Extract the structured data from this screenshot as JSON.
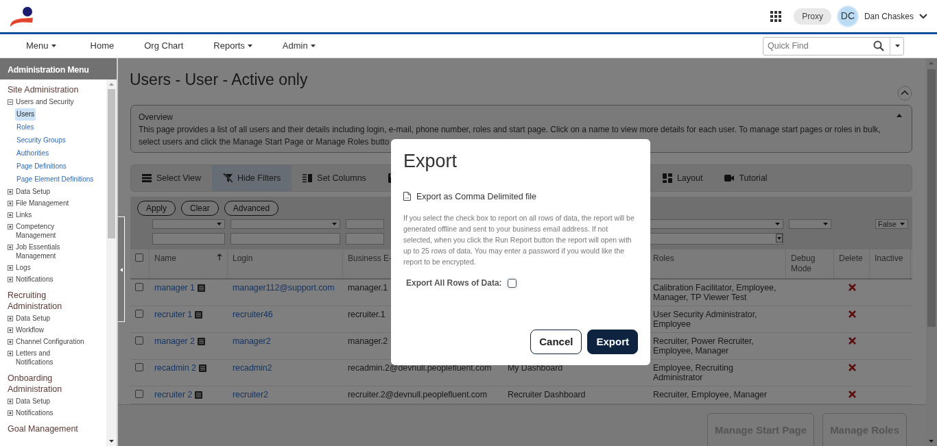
{
  "header": {
    "proxy": "Proxy",
    "avatar": "DC",
    "user": "Dan Chaskes"
  },
  "nav": [
    {
      "label": "Menu",
      "dropdown": true
    },
    {
      "label": "Home",
      "dropdown": false
    },
    {
      "label": "Org Chart",
      "dropdown": false
    },
    {
      "label": "Reports",
      "dropdown": true
    },
    {
      "label": "Admin",
      "dropdown": true
    }
  ],
  "quick_find": {
    "placeholder": "Quick Find"
  },
  "sidebar": {
    "title": "Administration Menu",
    "sections": [
      {
        "title": "Site Administration",
        "items": [
          {
            "label": "Users and Security",
            "expanded": true,
            "children": [
              {
                "label": "Users",
                "selected": true
              },
              {
                "label": "Roles",
                "selected": false
              },
              {
                "label": "Security Groups",
                "selected": false
              },
              {
                "label": "Authorities",
                "selected": false
              },
              {
                "label": "Page Definitions",
                "selected": false
              },
              {
                "label": "Page Element Definitions",
                "selected": false
              }
            ]
          },
          {
            "label": "Data Setup",
            "expanded": false
          },
          {
            "label": "File Management",
            "expanded": false
          },
          {
            "label": "Links",
            "expanded": false
          },
          {
            "label": "Competency Management",
            "expanded": false
          },
          {
            "label": "Job Essentials Management",
            "expanded": false
          },
          {
            "label": "Logs",
            "expanded": false
          },
          {
            "label": "Notifications",
            "expanded": false
          }
        ]
      },
      {
        "title": "Recruiting Administration",
        "items": [
          {
            "label": "Data Setup",
            "expanded": false
          },
          {
            "label": "Workflow",
            "expanded": false
          },
          {
            "label": "Channel Configuration",
            "expanded": false
          },
          {
            "label": "Letters and Notifications",
            "expanded": false
          }
        ]
      },
      {
        "title": "Onboarding Administration",
        "items": [
          {
            "label": "Data Setup",
            "expanded": false
          },
          {
            "label": "Notifications",
            "expanded": false
          }
        ]
      },
      {
        "title": "Goal Management"
      }
    ]
  },
  "page": {
    "title": "Users - User - Active only"
  },
  "overview": {
    "title": "Overview",
    "lines": [
      "This page provides a list of all users and their details including login, e-mail, phone number, roles and start page. Click on a name to view more details for each user. To manage start pages or roles in bulk,",
      "select users and click the Manage Start Page or Manage Roles butto"
    ]
  },
  "toolbar": [
    {
      "kind": "list",
      "label": "Select View",
      "selected": false
    },
    {
      "kind": "filter",
      "label": "Hide Filters",
      "selected": true
    },
    {
      "kind": "columns",
      "label": "Set Columns",
      "selected": false
    },
    {
      "kind": "save",
      "selected": false
    },
    {
      "kind": "layout",
      "label": "Layout",
      "selected": false
    },
    {
      "kind": "video",
      "label": "Tutorial",
      "selected": false
    }
  ],
  "filter_buttons": [
    "Apply",
    "Clear",
    "Advanced"
  ],
  "columns": [
    {
      "kind": "check",
      "checked": false
    },
    {
      "label": "Name",
      "sorted": true,
      "filters": [
        {
          "kind": "select"
        },
        {
          "kind": "text"
        }
      ]
    },
    {
      "label": "Login",
      "filters": [
        {
          "kind": "select"
        },
        {
          "kind": "text"
        }
      ]
    },
    {
      "label": "Business E-",
      "filters": [
        {
          "kind": "select"
        },
        {
          "kind": "text"
        }
      ]
    },
    {
      "kind": "hidden"
    },
    {
      "label": "Roles",
      "filters": [
        {
          "kind": "select"
        },
        {
          "kind": "dropdown"
        }
      ]
    },
    {
      "label": "Debug Mode",
      "filters": [
        {
          "kind": "select"
        }
      ]
    },
    {
      "label": "Delete"
    },
    {
      "label": "Inactive",
      "filters": [
        {
          "kind": "select",
          "value": "False"
        }
      ]
    }
  ],
  "rows": [
    {
      "checked": false,
      "name": "manager 1",
      "login": "manager112@support.com",
      "email": "manager.1",
      "roles": "Calibration Facilitator, Employee, Manager, TP Viewer Test",
      "delete": true
    },
    {
      "checked": false,
      "name": "recruiter 1",
      "login": "recruiter46",
      "email": "recruiter.1",
      "roles": "User Security Administrator, Employee",
      "delete": true
    },
    {
      "checked": false,
      "name": "manager 2",
      "login": "manager2",
      "email": "manager.2",
      "roles": "Recruiter, Power Recruiter, Employee, Manager",
      "delete": true
    },
    {
      "checked": false,
      "name": "recadmin 2",
      "login": "recadmin2",
      "email": "recadmin.2@devnull.peoplefluent.com",
      "start_page": "My Dashboard",
      "roles": "Employee, Recruiting Administrator",
      "delete": true
    },
    {
      "checked": false,
      "name": "recruiter 2",
      "login": "recruiter2",
      "email": "recruiter.2@devnull.peoplefluent.com",
      "start_page": "Recruiter Dashboard",
      "roles": "Recruiter, Employee, Manager",
      "delete": true
    }
  ],
  "footer_buttons": [
    {
      "label": "Manage Start Page",
      "disabled": true
    },
    {
      "label": "Manage Roles",
      "disabled": true
    }
  ],
  "modal": {
    "title": "Export",
    "option": "Export as Comma Delimited file",
    "text": "If you select the check box to report on all rows of data, the report will be generated offline and sent to your business email address. If not selected, when you click the Run Report button the report will open with up to 25 rows of data. You may enter a password if you would like the report to be encrypted.",
    "checkbox_label": "Export All Rows of Data:",
    "checked": false,
    "buttons": [
      {
        "kind": "secondary",
        "label": "Cancel"
      },
      {
        "kind": "primary",
        "label": "Export"
      }
    ]
  }
}
